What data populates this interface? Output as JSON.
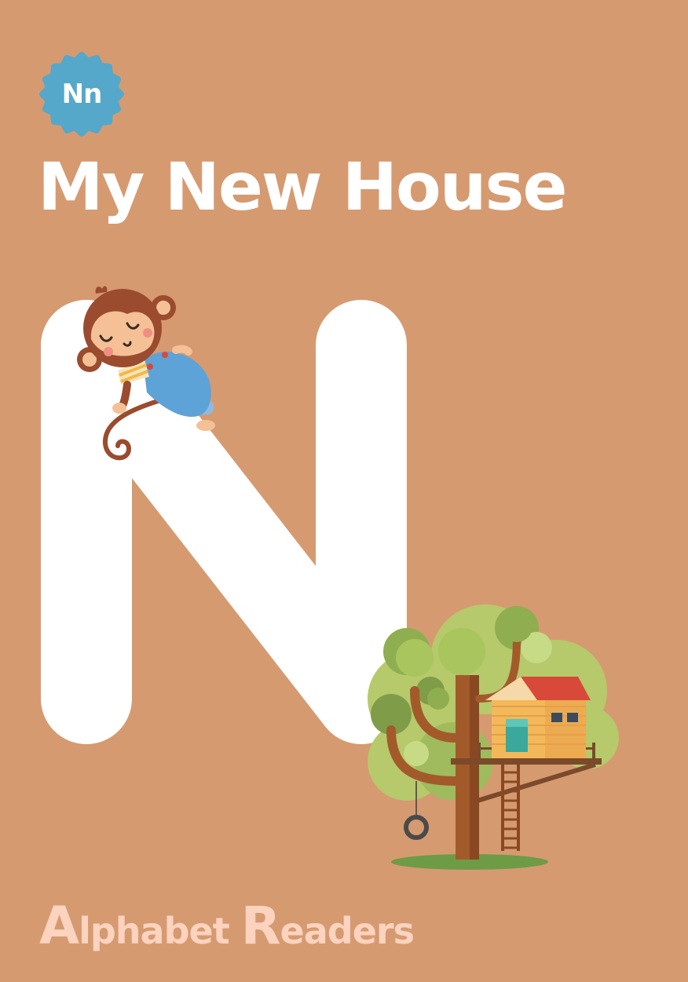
{
  "badge": {
    "label": "Nn"
  },
  "title": "My New House",
  "footer": {
    "word1_initial": "A",
    "word1_rest": "lphabet ",
    "word2_initial": "R",
    "word2_rest": "eaders"
  },
  "colors": {
    "background": "#d69a71",
    "badge": "#55a8c9",
    "title": "#ffffff",
    "letter": "#ffffff",
    "footer": "#fcd3bf"
  },
  "illustrations": {
    "letter_shape": "letter-n-shape",
    "character": "sleeping-monkey-icon",
    "scene": "treehouse-icon"
  }
}
